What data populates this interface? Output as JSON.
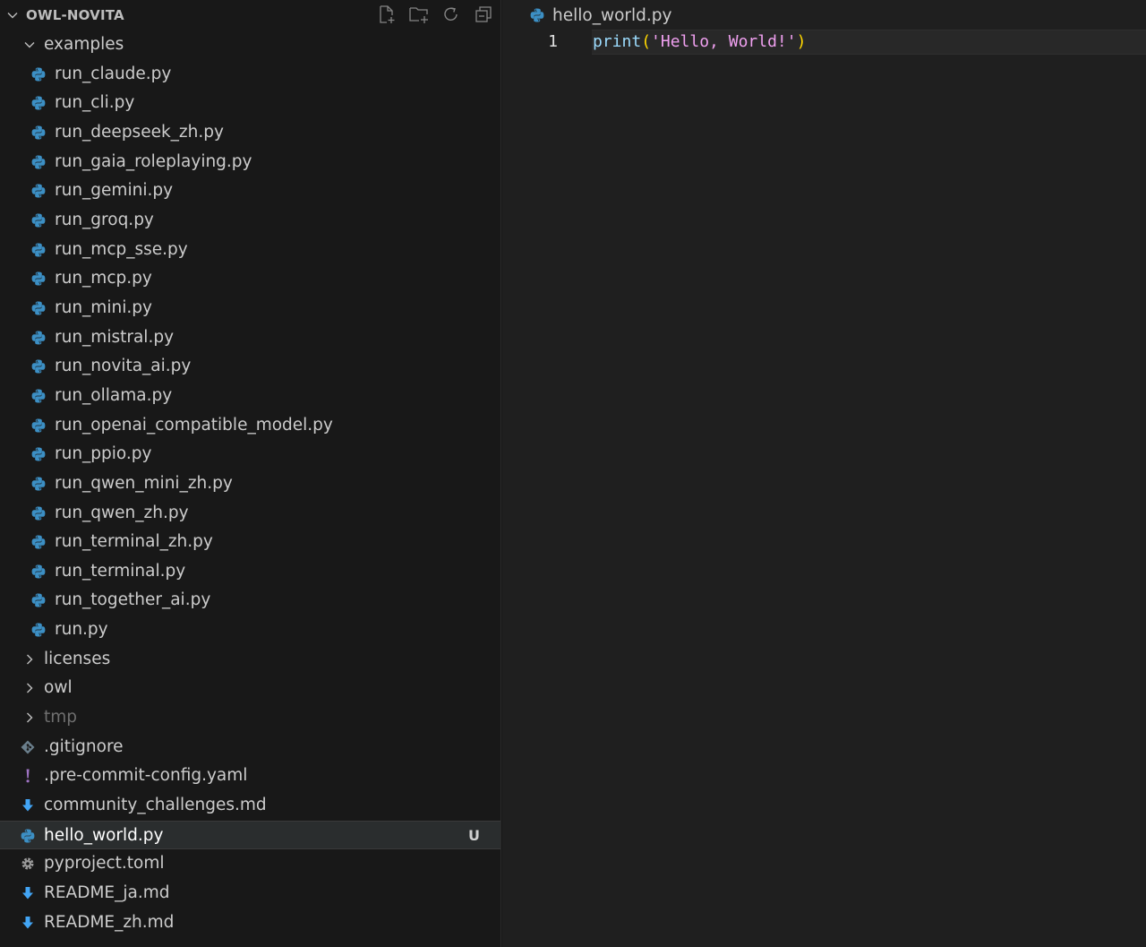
{
  "explorer": {
    "title": "OWL-NOVITA",
    "items": [
      {
        "label": "examples",
        "kind": "folder",
        "expanded": true,
        "depth": 1,
        "icon": "folder-chevron-down"
      },
      {
        "label": "run_claude.py",
        "kind": "file",
        "depth": 2,
        "icon": "python-icon"
      },
      {
        "label": "run_cli.py",
        "kind": "file",
        "depth": 2,
        "icon": "python-icon"
      },
      {
        "label": "run_deepseek_zh.py",
        "kind": "file",
        "depth": 2,
        "icon": "python-icon"
      },
      {
        "label": "run_gaia_roleplaying.py",
        "kind": "file",
        "depth": 2,
        "icon": "python-icon"
      },
      {
        "label": "run_gemini.py",
        "kind": "file",
        "depth": 2,
        "icon": "python-icon"
      },
      {
        "label": "run_groq.py",
        "kind": "file",
        "depth": 2,
        "icon": "python-icon"
      },
      {
        "label": "run_mcp_sse.py",
        "kind": "file",
        "depth": 2,
        "icon": "python-icon"
      },
      {
        "label": "run_mcp.py",
        "kind": "file",
        "depth": 2,
        "icon": "python-icon"
      },
      {
        "label": "run_mini.py",
        "kind": "file",
        "depth": 2,
        "icon": "python-icon"
      },
      {
        "label": "run_mistral.py",
        "kind": "file",
        "depth": 2,
        "icon": "python-icon"
      },
      {
        "label": "run_novita_ai.py",
        "kind": "file",
        "depth": 2,
        "icon": "python-icon"
      },
      {
        "label": "run_ollama.py",
        "kind": "file",
        "depth": 2,
        "icon": "python-icon"
      },
      {
        "label": "run_openai_compatible_model.py",
        "kind": "file",
        "depth": 2,
        "icon": "python-icon"
      },
      {
        "label": "run_ppio.py",
        "kind": "file",
        "depth": 2,
        "icon": "python-icon"
      },
      {
        "label": "run_qwen_mini_zh.py",
        "kind": "file",
        "depth": 2,
        "icon": "python-icon"
      },
      {
        "label": "run_qwen_zh.py",
        "kind": "file",
        "depth": 2,
        "icon": "python-icon"
      },
      {
        "label": "run_terminal_zh.py",
        "kind": "file",
        "depth": 2,
        "icon": "python-icon"
      },
      {
        "label": "run_terminal.py",
        "kind": "file",
        "depth": 2,
        "icon": "python-icon"
      },
      {
        "label": "run_together_ai.py",
        "kind": "file",
        "depth": 2,
        "icon": "python-icon"
      },
      {
        "label": "run.py",
        "kind": "file",
        "depth": 2,
        "icon": "python-icon"
      },
      {
        "label": "licenses",
        "kind": "folder",
        "expanded": false,
        "depth": 1,
        "icon": "folder-chevron-right"
      },
      {
        "label": "owl",
        "kind": "folder",
        "expanded": false,
        "depth": 1,
        "icon": "folder-chevron-right"
      },
      {
        "label": "tmp",
        "kind": "folder",
        "expanded": false,
        "depth": 1,
        "dim": true,
        "icon": "folder-chevron-right"
      },
      {
        "label": ".gitignore",
        "kind": "file",
        "depth": 1,
        "icon": "git-icon"
      },
      {
        "label": ".pre-commit-config.yaml",
        "kind": "file",
        "depth": 1,
        "icon": "yaml-icon"
      },
      {
        "label": "community_challenges.md",
        "kind": "file",
        "depth": 1,
        "icon": "markdown-icon"
      },
      {
        "label": "hello_world.py",
        "kind": "file",
        "depth": 1,
        "selected": true,
        "badge": "U",
        "icon": "python-icon"
      },
      {
        "label": "pyproject.toml",
        "kind": "file",
        "depth": 1,
        "icon": "gear-icon"
      },
      {
        "label": "README_ja.md",
        "kind": "file",
        "depth": 1,
        "icon": "markdown-icon"
      },
      {
        "label": "README_zh.md",
        "kind": "file",
        "depth": 1,
        "icon": "markdown-icon"
      }
    ]
  },
  "editor": {
    "breadcrumb": "hello_world.py",
    "lines": [
      {
        "number": "1",
        "code": "print('Hello, World!')"
      }
    ]
  },
  "colors": {
    "python_icon": "#3c8fc4",
    "markdown_icon": "#42a5f5",
    "yaml_icon": "#a074c4",
    "git_icon": "#6b7f8c"
  }
}
